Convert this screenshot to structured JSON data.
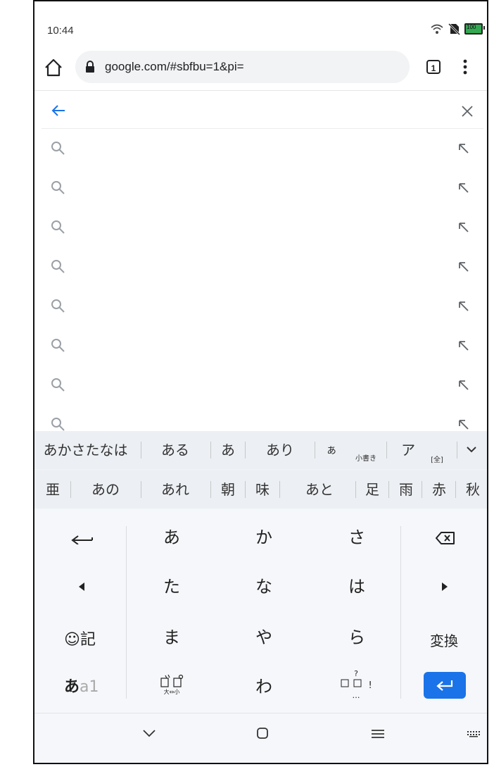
{
  "status_bar": {
    "time": "10:44",
    "battery": "100"
  },
  "toolbar": {
    "url": "google.com/#sbfbu=1&pi=",
    "tab_count": "1"
  },
  "suggestions_count": 8,
  "candidates_row1": [
    "あかさたなは",
    "ある",
    "あ",
    "あり",
    "ぁ",
    "ア"
  ],
  "candidates_row1_small": {
    "small_kana": "小書き",
    "full_width": "[全]"
  },
  "candidates_row2": [
    "亜",
    "あの",
    "あれ",
    "朝",
    "味",
    "あと",
    "足",
    "雨",
    "赤",
    "秋"
  ],
  "keyboard": {
    "row1": [
      "あ",
      "か",
      "さ"
    ],
    "row2": [
      "た",
      "な",
      "は"
    ],
    "row3": [
      "ま",
      "や",
      "ら"
    ],
    "row4": [
      "わ"
    ],
    "emoji_label": "記",
    "convert_label": "変換",
    "mode_label_a": "あ",
    "mode_label_b": "a1",
    "dakuten_sub": "大⇔小",
    "punct_top": "?",
    "punct_bottom": "…",
    "punct_mid": "!"
  },
  "colors": {
    "accent": "#1a73e8",
    "icon_gray": "#9aa0a6",
    "battery_green": "#34a853"
  }
}
